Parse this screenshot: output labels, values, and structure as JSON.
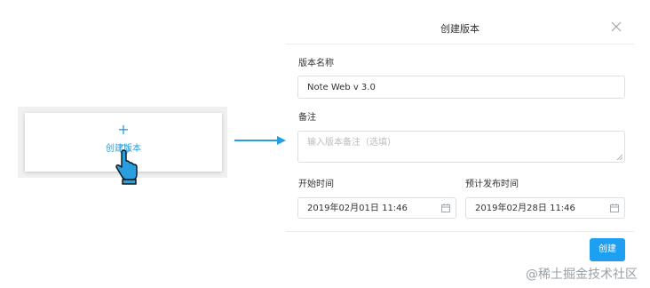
{
  "card": {
    "plus": "+",
    "label": "创建版本"
  },
  "dialog": {
    "title": "创建版本",
    "version_name_label": "版本名称",
    "version_name_value": "Note Web v 3.0",
    "note_label": "备注",
    "note_placeholder": "输入版本备注（选填）",
    "start_label": "开始时间",
    "start_value": "2019年02月01日 11:46",
    "release_label": "预计发布时间",
    "release_value": "2019年02月28日 11:46",
    "create_button": "创建"
  },
  "watermark": "@稀土掘金技术社区",
  "colors": {
    "accent": "#1e9ff2",
    "card_accent": "#2a9fe0"
  }
}
